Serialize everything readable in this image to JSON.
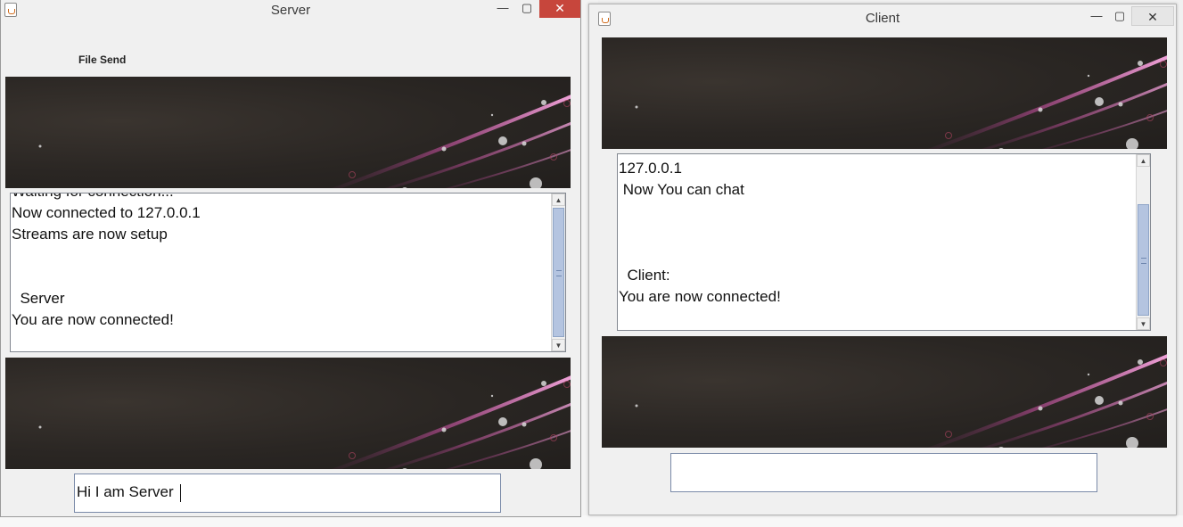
{
  "server": {
    "title": "Server",
    "menu_label": "File Send",
    "log_lines": [
      "Waiting for connection...",
      "Now connected to 127.0.0.1",
      "Streams are now setup",
      "",
      "",
      "  Server",
      "You are now connected!"
    ],
    "input_value": "Hi I am Server "
  },
  "client": {
    "title": "Client",
    "log_lines": [
      "127.0.0.1",
      " Now You can chat",
      "",
      "",
      "",
      "  Client:",
      "You are now connected!"
    ],
    "input_value": ""
  },
  "window_controls": {
    "minimize": "—",
    "maximize": "▢",
    "close": "✕"
  },
  "colors": {
    "close_active": "#c7463c",
    "scroll_thumb": "#b4c4e0",
    "banner_dark": "#2a2623",
    "banner_streak": "#c14e9b"
  }
}
